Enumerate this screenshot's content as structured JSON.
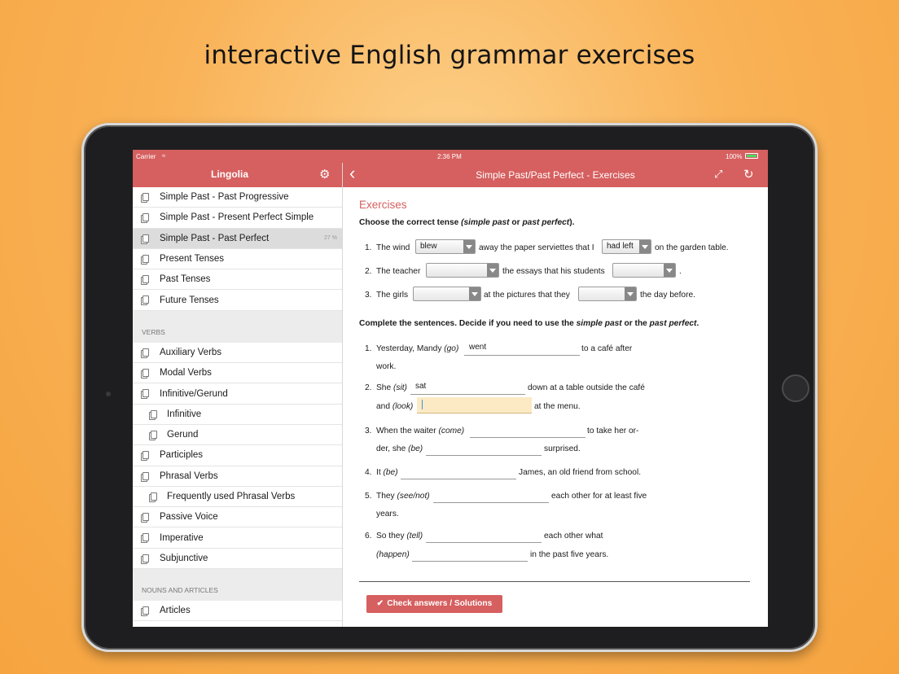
{
  "headline": "interactive English grammar exercises",
  "status": {
    "carrier": "Carrier",
    "time": "2:36 PM",
    "battery": "100%"
  },
  "sidebar": {
    "brand": "Lingolia",
    "items_top": [
      {
        "label": "Simple Past - Past Progressive"
      },
      {
        "label": "Simple Past - Present Perfect Simple"
      },
      {
        "label": "Simple Past - Past Perfect",
        "progress": "27 %"
      },
      {
        "label": "Present Tenses"
      },
      {
        "label": "Past Tenses"
      },
      {
        "label": "Future Tenses"
      }
    ],
    "section_verbs": "VERBS",
    "items_verbs": [
      {
        "label": "Auxiliary Verbs"
      },
      {
        "label": "Modal Verbs"
      },
      {
        "label": "Infinitive/Gerund"
      },
      {
        "label": "Infinitive"
      },
      {
        "label": "Gerund"
      },
      {
        "label": "Participles"
      },
      {
        "label": "Phrasal Verbs"
      },
      {
        "label": "Frequently used Phrasal Verbs"
      },
      {
        "label": "Passive Voice"
      },
      {
        "label": "Imperative"
      },
      {
        "label": "Subjunctive"
      }
    ],
    "section_nouns": "NOUNS AND ARTICLES",
    "items_nouns": [
      {
        "label": "Articles"
      }
    ]
  },
  "main": {
    "nav_title": "Simple Past/Past Perfect - Exercises",
    "heading": "Exercises",
    "part1": {
      "instruction_a": "Choose the correct tense ",
      "instruction_b": "(simple past",
      "instruction_c": " or ",
      "instruction_d": "past perfect",
      "instruction_e": ").",
      "q1": {
        "n": "1.",
        "a": "The wind",
        "sel1": "blew",
        "b": "away the paper serviettes that I",
        "sel2": "had left",
        "c": "on the garden table."
      },
      "q2": {
        "n": "2.",
        "a": "The teacher",
        "sel1": "",
        "b": "the essays that his students",
        "sel2": "",
        "c": "."
      },
      "q3": {
        "n": "3.",
        "a": "The girls",
        "sel1": "",
        "b": "at the pictures that they",
        "sel2": "",
        "c": "the day before."
      }
    },
    "part2": {
      "instruction_a": "Complete the sentences. Decide if you need to use the ",
      "instruction_b": "simple past",
      "instruction_c": " or the ",
      "instruction_d": "past perfect",
      "instruction_e": ".",
      "s1": {
        "n": "1.",
        "a": "Yesterday, Mandy ",
        "hint": "(go)",
        "val": "went",
        "b": "to a café after",
        "c": "work."
      },
      "s2": {
        "n": "2.",
        "a": "She ",
        "hint": "(sit)",
        "val": "sat",
        "b": "down at a table outside the café",
        "c": "and ",
        "hint2": "(look)",
        "val2": "",
        "d": "at the menu."
      },
      "s3": {
        "n": "3.",
        "a": "When the waiter ",
        "hint": "(come)",
        "val": "",
        "b": "to take her or-",
        "c": "der, she ",
        "hint2": "(be)",
        "val2": "",
        "d": "surprised."
      },
      "s4": {
        "n": "4.",
        "a": "It ",
        "hint": "(be)",
        "val": "",
        "b": "James, an old friend from school."
      },
      "s5": {
        "n": "5.",
        "a": "They ",
        "hint": "(see/not)",
        "val": "",
        "b": "each other for at least five",
        "c": "years."
      },
      "s6": {
        "n": "6.",
        "a": "So they ",
        "hint": "(tell)",
        "val": "",
        "b": "each other what",
        "hint2": "(happen)",
        "val2": "",
        "d": "in the past five years."
      }
    },
    "check_button": "Check answers / Solutions"
  }
}
